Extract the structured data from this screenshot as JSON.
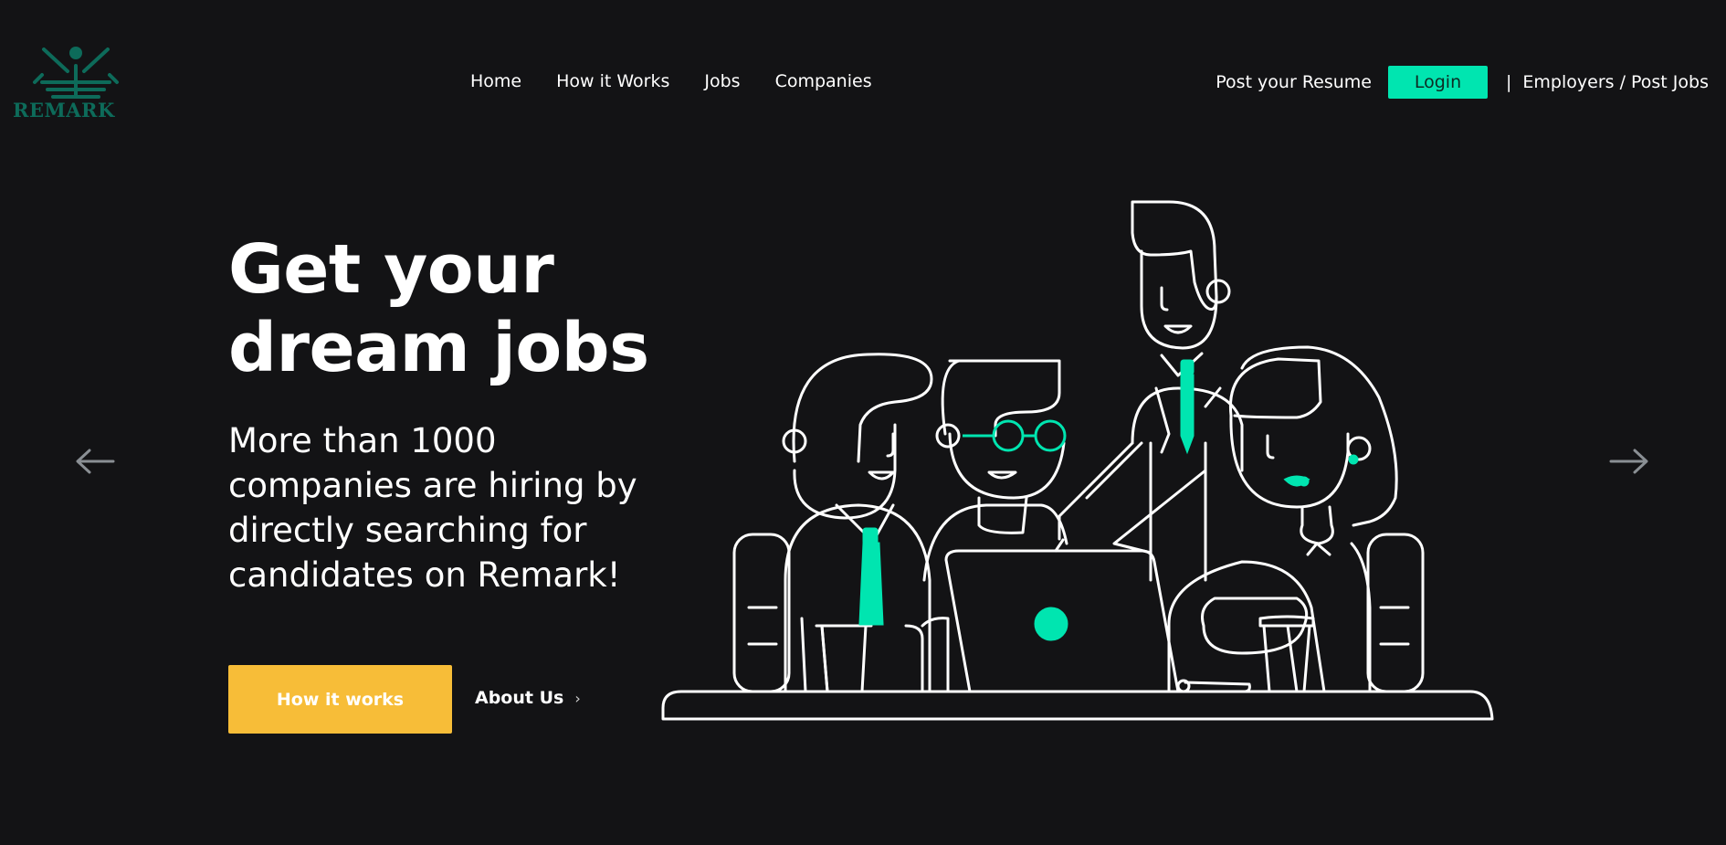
{
  "brand": {
    "logo_text": "REMARK",
    "logo_color": "#0d6b5a",
    "logo_icon": "remark-logo-icon"
  },
  "nav": {
    "items": [
      {
        "label": "Home"
      },
      {
        "label": "How it Works"
      },
      {
        "label": "Jobs"
      },
      {
        "label": "Companies"
      }
    ]
  },
  "account": {
    "post_resume_label": "Post your Resume",
    "login_label": "Login",
    "separator": "|",
    "employers_label": "Employers / Post Jobs"
  },
  "hero": {
    "title_lines": [
      "Get your",
      "dream jobs"
    ],
    "subtitle_lines": [
      "More than 1000",
      "companies are hiring by",
      "directly searching for",
      "candidates on Remark!"
    ],
    "primary_cta_label": "How it works",
    "secondary_cta_label": "About Us",
    "secondary_cta_icon": "chevron-right-icon",
    "illustration": "team-at-laptop-illustration"
  },
  "carousel": {
    "prev_icon": "arrow-left-icon",
    "next_icon": "arrow-right-icon"
  },
  "colors": {
    "background": "#131315",
    "accent": "#00e5b0",
    "cta": "#f7bd38",
    "text": "#ffffff",
    "arrow": "#8a8f94"
  }
}
